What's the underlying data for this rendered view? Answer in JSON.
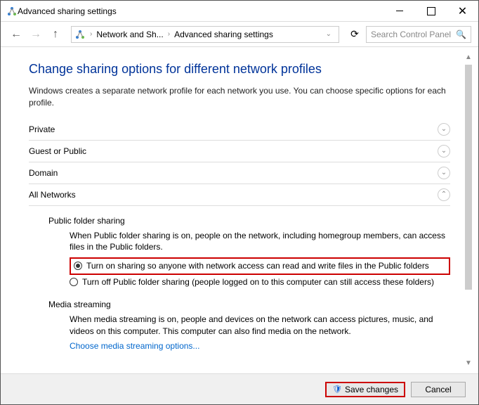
{
  "window": {
    "title": "Advanced sharing settings"
  },
  "nav": {
    "crumb1": "Network and Sh...",
    "crumb2": "Advanced sharing settings",
    "search_placeholder": "Search Control Panel"
  },
  "page": {
    "heading": "Change sharing options for different network profiles",
    "subtext": "Windows creates a separate network profile for each network you use. You can choose specific options for each profile."
  },
  "sections": {
    "private": "Private",
    "guest": "Guest or Public",
    "domain": "Domain",
    "all": "All Networks"
  },
  "public_folder": {
    "title": "Public folder sharing",
    "desc": "When Public folder sharing is on, people on the network, including homegroup members, can access files in the Public folders.",
    "opt_on": "Turn on sharing so anyone with network access can read and write files in the Public folders",
    "opt_off": "Turn off Public folder sharing (people logged on to this computer can still access these folders)"
  },
  "media": {
    "title": "Media streaming",
    "desc": "When media streaming is on, people and devices on the network can access pictures, music, and videos on this computer. This computer can also find media on the network.",
    "link": "Choose media streaming options..."
  },
  "buttons": {
    "save": "Save changes",
    "cancel": "Cancel"
  }
}
